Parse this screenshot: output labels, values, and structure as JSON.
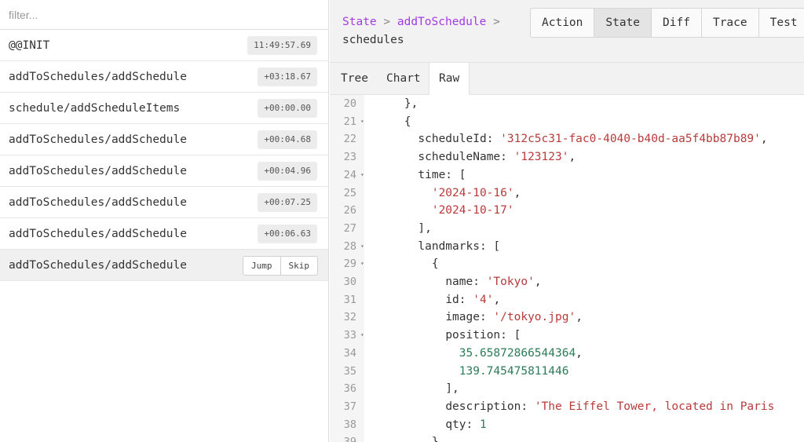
{
  "filter": {
    "placeholder": "filter..."
  },
  "actions": [
    {
      "name": "@@INIT",
      "time": "11:49:57.69"
    },
    {
      "name": "addToSchedules/addSchedule",
      "time": "+03:18.67"
    },
    {
      "name": "schedule/addScheduleItems",
      "time": "+00:00.00"
    },
    {
      "name": "addToSchedules/addSchedule",
      "time": "+00:04.68"
    },
    {
      "name": "addToSchedules/addSchedule",
      "time": "+00:04.96"
    },
    {
      "name": "addToSchedules/addSchedule",
      "time": "+00:07.25"
    },
    {
      "name": "addToSchedules/addSchedule",
      "time": "+00:06.63"
    },
    {
      "name": "addToSchedules/addSchedule",
      "selected": true,
      "jump_label": "Jump",
      "skip_label": "Skip"
    }
  ],
  "breadcrumb": {
    "state": "State",
    "sep1": " > ",
    "action": "addToSchedule",
    "sep2": " > ",
    "current": "schedules"
  },
  "main_tabs": [
    "Action",
    "State",
    "Diff",
    "Trace",
    "Test"
  ],
  "main_tab_active": "State",
  "sub_tabs": [
    "Tree",
    "Chart",
    "Raw"
  ],
  "sub_tab_active": "Raw",
  "colors": {
    "link": "#a33ae0",
    "string": "#b83b3b",
    "number": "#2c7b59"
  },
  "code_lines": [
    {
      "n": "20",
      "fold": false,
      "indent": 4,
      "parts": [
        [
          "pun",
          "},"
        ]
      ]
    },
    {
      "n": "21",
      "fold": true,
      "indent": 4,
      "parts": [
        [
          "pun",
          "{"
        ]
      ]
    },
    {
      "n": "22",
      "fold": false,
      "indent": 6,
      "parts": [
        [
          "key",
          "scheduleId: "
        ],
        [
          "str",
          "'312c5c31-fac0-4040-b40d-aa5f4bb87b89'"
        ],
        [
          "pun",
          ","
        ]
      ]
    },
    {
      "n": "23",
      "fold": false,
      "indent": 6,
      "parts": [
        [
          "key",
          "scheduleName: "
        ],
        [
          "str",
          "'123123'"
        ],
        [
          "pun",
          ","
        ]
      ]
    },
    {
      "n": "24",
      "fold": true,
      "indent": 6,
      "parts": [
        [
          "key",
          "time: "
        ],
        [
          "pun",
          "["
        ]
      ]
    },
    {
      "n": "25",
      "fold": false,
      "indent": 8,
      "parts": [
        [
          "str",
          "'2024-10-16'"
        ],
        [
          "pun",
          ","
        ]
      ]
    },
    {
      "n": "26",
      "fold": false,
      "indent": 8,
      "parts": [
        [
          "str",
          "'2024-10-17'"
        ]
      ]
    },
    {
      "n": "27",
      "fold": false,
      "indent": 6,
      "parts": [
        [
          "pun",
          "],"
        ]
      ]
    },
    {
      "n": "28",
      "fold": true,
      "indent": 6,
      "parts": [
        [
          "key",
          "landmarks: "
        ],
        [
          "pun",
          "["
        ]
      ]
    },
    {
      "n": "29",
      "fold": true,
      "indent": 8,
      "parts": [
        [
          "pun",
          "{"
        ]
      ]
    },
    {
      "n": "30",
      "fold": false,
      "indent": 10,
      "parts": [
        [
          "key",
          "name: "
        ],
        [
          "str",
          "'Tokyo'"
        ],
        [
          "pun",
          ","
        ]
      ]
    },
    {
      "n": "31",
      "fold": false,
      "indent": 10,
      "parts": [
        [
          "key",
          "id: "
        ],
        [
          "str",
          "'4'"
        ],
        [
          "pun",
          ","
        ]
      ]
    },
    {
      "n": "32",
      "fold": false,
      "indent": 10,
      "parts": [
        [
          "key",
          "image: "
        ],
        [
          "str",
          "'/tokyo.jpg'"
        ],
        [
          "pun",
          ","
        ]
      ]
    },
    {
      "n": "33",
      "fold": true,
      "indent": 10,
      "parts": [
        [
          "key",
          "position: "
        ],
        [
          "pun",
          "["
        ]
      ]
    },
    {
      "n": "34",
      "fold": false,
      "indent": 12,
      "parts": [
        [
          "num",
          "35.65872866544364"
        ],
        [
          "pun",
          ","
        ]
      ]
    },
    {
      "n": "35",
      "fold": false,
      "indent": 12,
      "parts": [
        [
          "num",
          "139.745475811446"
        ]
      ]
    },
    {
      "n": "36",
      "fold": false,
      "indent": 10,
      "parts": [
        [
          "pun",
          "],"
        ]
      ]
    },
    {
      "n": "37",
      "fold": false,
      "indent": 10,
      "parts": [
        [
          "key",
          "description: "
        ],
        [
          "str",
          "'The Eiffel Tower, located in Paris"
        ]
      ]
    },
    {
      "n": "38",
      "fold": false,
      "indent": 10,
      "parts": [
        [
          "key",
          "qty: "
        ],
        [
          "num",
          "1"
        ]
      ]
    },
    {
      "n": "39",
      "fold": false,
      "indent": 8,
      "parts": [
        [
          "pun",
          "}"
        ]
      ]
    }
  ]
}
